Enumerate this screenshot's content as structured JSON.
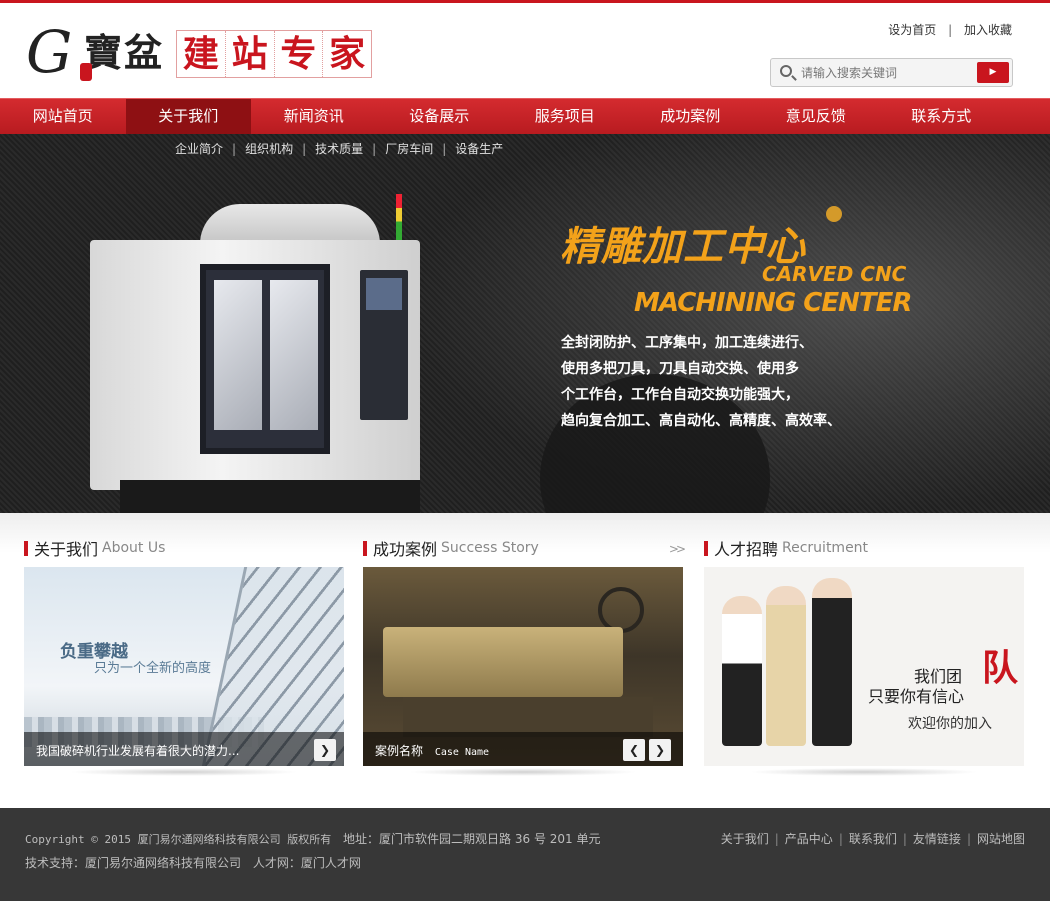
{
  "header": {
    "logo": {
      "g": "G",
      "trad": "寶盆",
      "brand": [
        "建",
        "站",
        "专",
        "家"
      ]
    },
    "toplinks": {
      "home": "设为首页",
      "separator": "|",
      "favorite": "加入收藏"
    },
    "search": {
      "placeholder": "请输入搜索关键词",
      "button_icon": "arrow-right-icon"
    }
  },
  "nav": {
    "items": [
      "网站首页",
      "关于我们",
      "新闻资讯",
      "设备展示",
      "服务项目",
      "成功案例",
      "意见反馈",
      "联系方式"
    ],
    "active_index": 1,
    "subitems": [
      "企业简介",
      "组织机构",
      "技术质量",
      "厂房车间",
      "设备生产"
    ]
  },
  "banner": {
    "title": "精雕加工中心",
    "en_line1": "CARVED CNC",
    "en_line2": "MACHINING CENTER",
    "desc": [
      "全封闭防护、工序集中，加工连续进行、",
      "使用多把刀具，刀具自动交换、使用多",
      "个工作台，工作台自动交换功能强大，",
      "趋向复合加工、高自动化、高精度、高效率、"
    ]
  },
  "sections": {
    "about": {
      "title": "关于我们",
      "en": "About Us",
      "img_title": "负重攀越",
      "img_sub": "只为一个全新的高度",
      "caption": "我国破碎机行业发展有着很大的潜力..."
    },
    "cases": {
      "title": "成功案例",
      "en": "Success Story",
      "more": ">>",
      "caption_zh": "案例名称",
      "caption_en": "Case Name"
    },
    "jobs": {
      "title": "人才招聘",
      "en": "Recruitment",
      "line1": "我们团",
      "big": "队",
      "line2": "只要你有信心",
      "line3": "欢迎你的加入"
    }
  },
  "footer": {
    "copyright": "Copyright © 2015 厦门易尔通网络科技有限公司 版权所有",
    "address": "地址：厦门市软件园二期观日路 36 号 201 单元",
    "support": "技术支持：厦门易尔通网络科技有限公司",
    "talent": "人才网：厦门人才网",
    "links": [
      "关于我们",
      "产品中心",
      "联系我们",
      "友情链接",
      "网站地图"
    ]
  },
  "colors": {
    "brand_red": "#c9151e",
    "banner_gold": "#f3a21a",
    "footer_bg": "#373737"
  }
}
